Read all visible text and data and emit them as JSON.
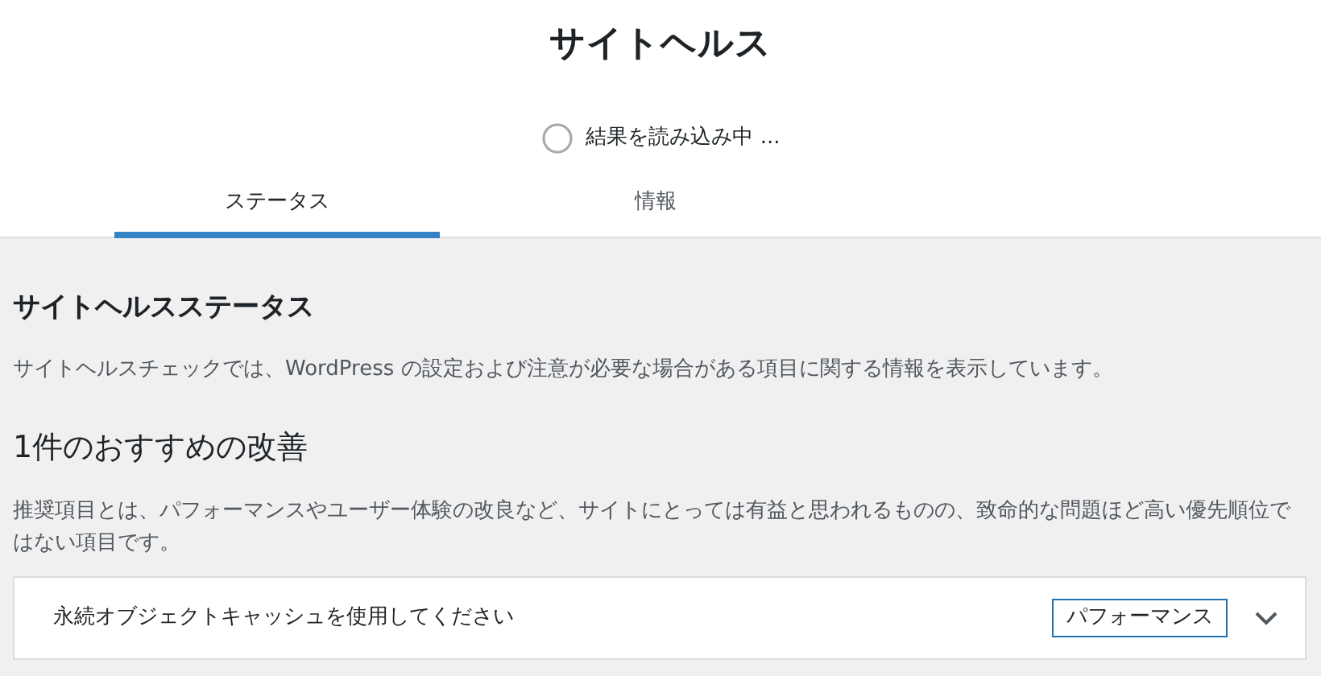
{
  "header": {
    "title": "サイトヘルス",
    "loading_text": "結果を読み込み中 ..."
  },
  "tabs": [
    {
      "label": "ステータス",
      "selected": true
    },
    {
      "label": "情報",
      "selected": false
    }
  ],
  "status_section": {
    "heading": "サイトヘルスステータス",
    "description": "サイトヘルスチェックでは、WordPress の設定および注意が必要な場合がある項目に関する情報を表示しています。"
  },
  "recommended_section": {
    "heading": "1件のおすすめの改善",
    "description": "推奨項目とは、パフォーマンスやユーザー体験の改良など、サイトにとっては有益と思われるものの、致命的な問題ほど高い優先順位ではない項目です。",
    "items": [
      {
        "title": "永続オブジェクトキャッシュを使用してください",
        "badge": "パフォーマンス",
        "expanded": false
      }
    ]
  }
}
